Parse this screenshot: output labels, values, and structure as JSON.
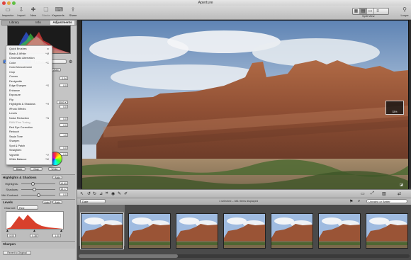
{
  "window": {
    "title": "Aperture"
  },
  "toolbar": {
    "left_buttons": [
      {
        "label": "Inspector",
        "icon": "inspector-icon"
      },
      {
        "label": "Import",
        "icon": "import-icon"
      },
      {
        "label": "New",
        "icon": "plus-icon"
      },
      {
        "label": "Stacks",
        "icon": "stack-icon"
      },
      {
        "label": "Keywords",
        "icon": "keywords-icon"
      },
      {
        "label": "Share",
        "icon": "share-icon"
      }
    ],
    "view_label": "Split View",
    "loupe_label": "Loupe"
  },
  "inspector": {
    "tabs": [
      "Library",
      "Info",
      "Adjustments"
    ],
    "active_tab": "Adjustments",
    "histogram_info": [
      "R 65",
      "G 70",
      "B 58"
    ],
    "add_adjustment_label": "Add Adjustment",
    "effects_label": "Effects",
    "auto_label": "Auto",
    "sections": [
      {
        "title": "Highlights & Shadows",
        "rows": [
          {
            "label": "Highlights:",
            "value": "14.69"
          },
          {
            "label": "Shadows:",
            "value": "18.17"
          },
          {
            "label": "Mid Contrast:",
            "value": "0.0"
          }
        ]
      },
      {
        "title": "Levels",
        "channel_label": "Channel:",
        "channel_value": "Red"
      },
      {
        "title": "Sharpen"
      }
    ],
    "levels_readouts": [
      "0.00",
      "0.38",
      "1.00"
    ],
    "wb_buttons": [
      "Black",
      "Gray",
      "White"
    ],
    "revert_label": "Revert to Original",
    "dim_values": [
      "0.04",
      "0.0",
      "5000 K",
      "0.0",
      "0.0",
      "0.0",
      "1.0",
      "0.0",
      "0.0"
    ]
  },
  "adjust_menu": {
    "items": [
      {
        "label": "Quick Brushes",
        "shortcut": "▸",
        "dim": false
      },
      {
        "label": "Black & White",
        "shortcut": "^M",
        "dim": false
      },
      {
        "label": "Chromatic Aberration",
        "shortcut": "",
        "dim": false
      },
      {
        "label": "Color",
        "shortcut": "^C",
        "dim": false
      },
      {
        "label": "Color Monochrome",
        "shortcut": "",
        "dim": false
      },
      {
        "label": "Crop",
        "shortcut": "",
        "dim": false
      },
      {
        "label": "Curves",
        "shortcut": "",
        "dim": false
      },
      {
        "label": "Devignette",
        "shortcut": "",
        "dim": false
      },
      {
        "label": "Edge Sharpen",
        "shortcut": "^S",
        "dim": false
      },
      {
        "label": "Enhance",
        "shortcut": "",
        "dim": false
      },
      {
        "label": "Exposure",
        "shortcut": "",
        "dim": false
      },
      {
        "label": "Flip",
        "shortcut": "",
        "dim": false
      },
      {
        "label": "Highlights & Shadows",
        "shortcut": "^H",
        "dim": false
      },
      {
        "label": "iPhoto Effects",
        "shortcut": "",
        "dim": false
      },
      {
        "label": "Levels",
        "shortcut": "",
        "dim": false
      },
      {
        "label": "Noise Reduction",
        "shortcut": "^N",
        "dim": false
      },
      {
        "label": "RAW Fine Tuning",
        "shortcut": "",
        "dim": true
      },
      {
        "label": "Red Eye Correction",
        "shortcut": "",
        "dim": false
      },
      {
        "label": "Retouch",
        "shortcut": "",
        "dim": false
      },
      {
        "label": "Sepia Tone",
        "shortcut": "",
        "dim": false
      },
      {
        "label": "Sharpen",
        "shortcut": "",
        "dim": false
      },
      {
        "label": "Spot & Patch",
        "shortcut": "",
        "dim": false
      },
      {
        "label": "Straighten",
        "shortcut": "",
        "dim": false
      },
      {
        "label": "Vignette",
        "shortcut": "^V",
        "dim": false
      },
      {
        "label": "White Balance",
        "shortcut": "^W",
        "dim": false
      }
    ]
  },
  "viewer": {
    "zoom_readout": "33%"
  },
  "browser": {
    "sort_label": "Date",
    "status_text": "1 selected – 381 items displayed",
    "filter_label": "Unrated or Better",
    "thumbnail_count": 7,
    "selected_index": 0
  },
  "colors": {
    "accent": "#3b73d6",
    "sky": "#8fb4d9",
    "rock": "#9a5a3c"
  }
}
